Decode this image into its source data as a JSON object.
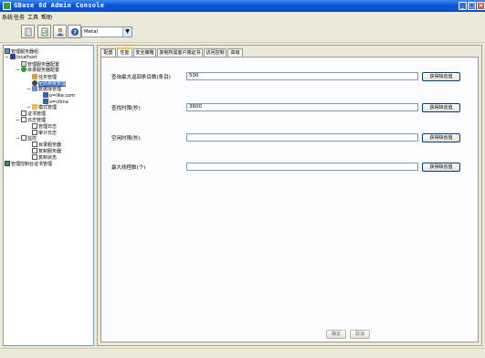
{
  "window": {
    "title": "GBase 8d  Admin  Console"
  },
  "menu": [
    "系统",
    "任务",
    "工具",
    "帮助"
  ],
  "toolbar": {
    "look_and_feel": "Metal"
  },
  "tree": {
    "nodes": [
      {
        "label": "管理服务器组"
      },
      {
        "label": "localhost"
      },
      {
        "label": "管理服务器配置"
      },
      {
        "label": "目录服务器配置"
      },
      {
        "label": "任务管理"
      },
      {
        "label": "全局参数管理"
      },
      {
        "label": "数据库管理"
      },
      {
        "label": "o=like.com"
      },
      {
        "label": "o=china"
      },
      {
        "label": "模式管理"
      },
      {
        "label": "证书管理"
      },
      {
        "label": "日志管理"
      },
      {
        "label": "管理日志"
      },
      {
        "label": "审计日志"
      },
      {
        "label": "监控"
      },
      {
        "label": "目录服务器"
      },
      {
        "label": "复制服务器"
      },
      {
        "label": "复制状态"
      },
      {
        "label": "管理控制台证书管理"
      }
    ]
  },
  "tabs": [
    "配置",
    "性能",
    "安全策略",
    "复制所需客户端证书",
    "访问控制",
    "高级"
  ],
  "form": {
    "rows": [
      {
        "label": "查询最大返回条目数(条目)",
        "value": "500",
        "button": "获得缺省值"
      },
      {
        "label": "查找时限(秒)",
        "value": "3600",
        "button": "获得缺省值"
      },
      {
        "label": "空闲时限(秒)",
        "value": "",
        "button": "获得缺省值"
      },
      {
        "label": "最大线程数(个)",
        "value": "",
        "button": "获得缺省值"
      }
    ],
    "ok_label": "确定",
    "cancel_label": "取消"
  }
}
